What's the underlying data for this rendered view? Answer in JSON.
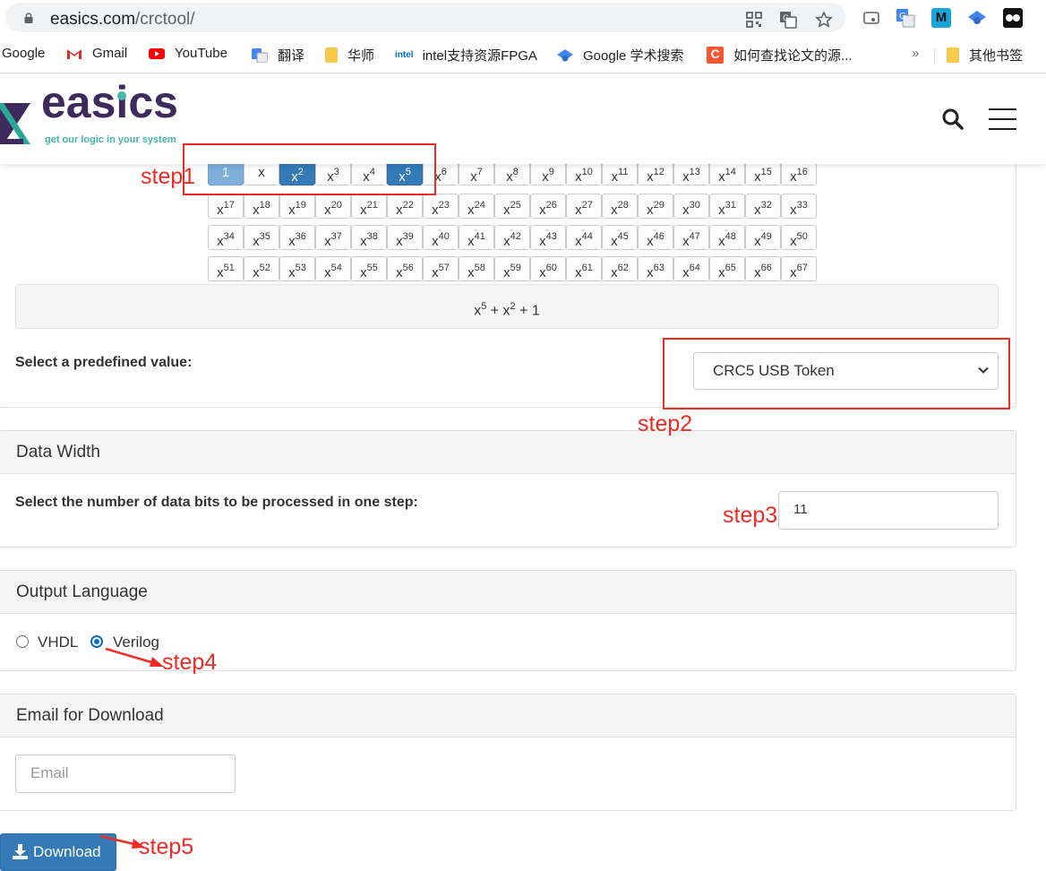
{
  "browser": {
    "url_host": "easics.com",
    "url_path": "/crctool/",
    "bookmarks": [
      {
        "label": "Google",
        "icon": "google-icon"
      },
      {
        "label": "Gmail",
        "icon": "gmail-icon",
        "color": "#d93025"
      },
      {
        "label": "YouTube",
        "icon": "youtube-icon",
        "color": "#ff0000"
      },
      {
        "label": "翻译",
        "icon": "translate-icon",
        "color": "#4285f4"
      },
      {
        "label": "华师",
        "icon": "folder-icon"
      },
      {
        "label": "intel支持资源FPGA",
        "icon": "intel-icon",
        "prefix": "intel",
        "color": "#0071c5"
      },
      {
        "label": "Google 学术搜索",
        "icon": "scholar-icon",
        "color": "#4285f4"
      },
      {
        "label": "如何查找论文的源...",
        "icon": "csdn-icon",
        "color": "#fc5531"
      },
      {
        "label": "其他书签",
        "icon": "folder-icon"
      }
    ],
    "more": "»"
  },
  "site": {
    "logo": "easics",
    "tagline": "get our logic in your system"
  },
  "polynomial": {
    "degrees": [
      {
        "label": "1",
        "sup": "",
        "state": "light"
      },
      {
        "label": "x",
        "sup": "",
        "state": "off"
      },
      {
        "label": "x",
        "sup": "2",
        "state": "on"
      },
      {
        "label": "x",
        "sup": "3",
        "state": "off"
      },
      {
        "label": "x",
        "sup": "4",
        "state": "off"
      },
      {
        "label": "x",
        "sup": "5",
        "state": "on"
      }
    ],
    "max_degree": 67,
    "display_terms": [
      {
        "base": "x",
        "sup": "5"
      },
      {
        "sep": " + "
      },
      {
        "base": "x",
        "sup": "2"
      },
      {
        "sep": " + 1"
      }
    ],
    "predefined_label": "Select a predefined value:",
    "predefined_value": "CRC5 USB Token"
  },
  "data_width": {
    "title": "Data Width",
    "label": "Select the number of data bits to be processed in one step:",
    "value": "11"
  },
  "output_language": {
    "title": "Output Language",
    "options": [
      "VHDL",
      "Verilog"
    ],
    "selected": "Verilog"
  },
  "email": {
    "title": "Email for Download",
    "placeholder": "Email"
  },
  "download_label": "Download",
  "annotations": {
    "step1": "step1",
    "step2": "step2",
    "step3": "step3",
    "step4": "step4",
    "step5": "step5",
    "color": "#ee2b24"
  }
}
